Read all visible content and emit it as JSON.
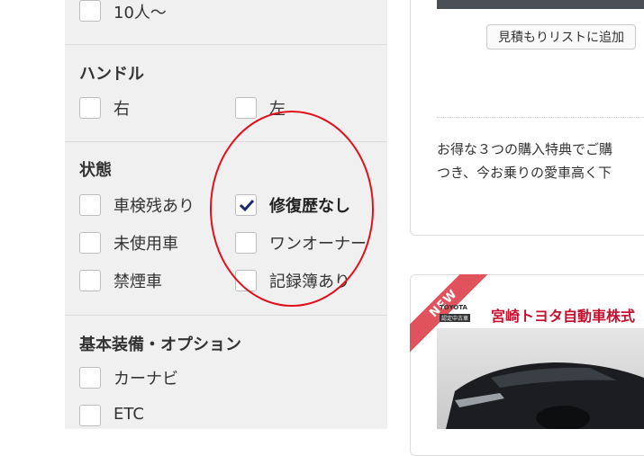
{
  "filters": {
    "capacity": {
      "option_label": "10人～"
    },
    "handle": {
      "title": "ハンドル",
      "options": [
        {
          "label": "右",
          "checked": false
        },
        {
          "label": "左",
          "checked": false
        }
      ]
    },
    "condition": {
      "title": "状態",
      "options": [
        {
          "label": "車検残あり",
          "checked": false
        },
        {
          "label": "修復歴なし",
          "checked": true
        },
        {
          "label": "未使用車",
          "checked": false
        },
        {
          "label": "ワンオーナー",
          "checked": false
        },
        {
          "label": "禁煙車",
          "checked": false
        },
        {
          "label": "記録簿あり",
          "checked": false
        }
      ]
    },
    "equipment": {
      "title": "基本装備・オプション",
      "options": [
        {
          "label": "カーナビ",
          "checked": false
        },
        {
          "label": "ETC",
          "checked": false
        }
      ]
    }
  },
  "listing": {
    "estimate_button": "見積もりリストに追加",
    "promo_line1": "お得な３つの購入特典でご購",
    "promo_line2": "つき、今お乗りの愛車高く下"
  },
  "dealer_card": {
    "badge": "NEW",
    "logo_brand": "TOYOTA",
    "logo_sub": "認定中古車",
    "dealer_name": "宮崎トヨタ自動車株式"
  },
  "colors": {
    "annotation_circle": "#e0101a",
    "checkmark": "#1a2a6c",
    "new_badge": "#e0525c",
    "dealer_name": "#c8102e"
  }
}
